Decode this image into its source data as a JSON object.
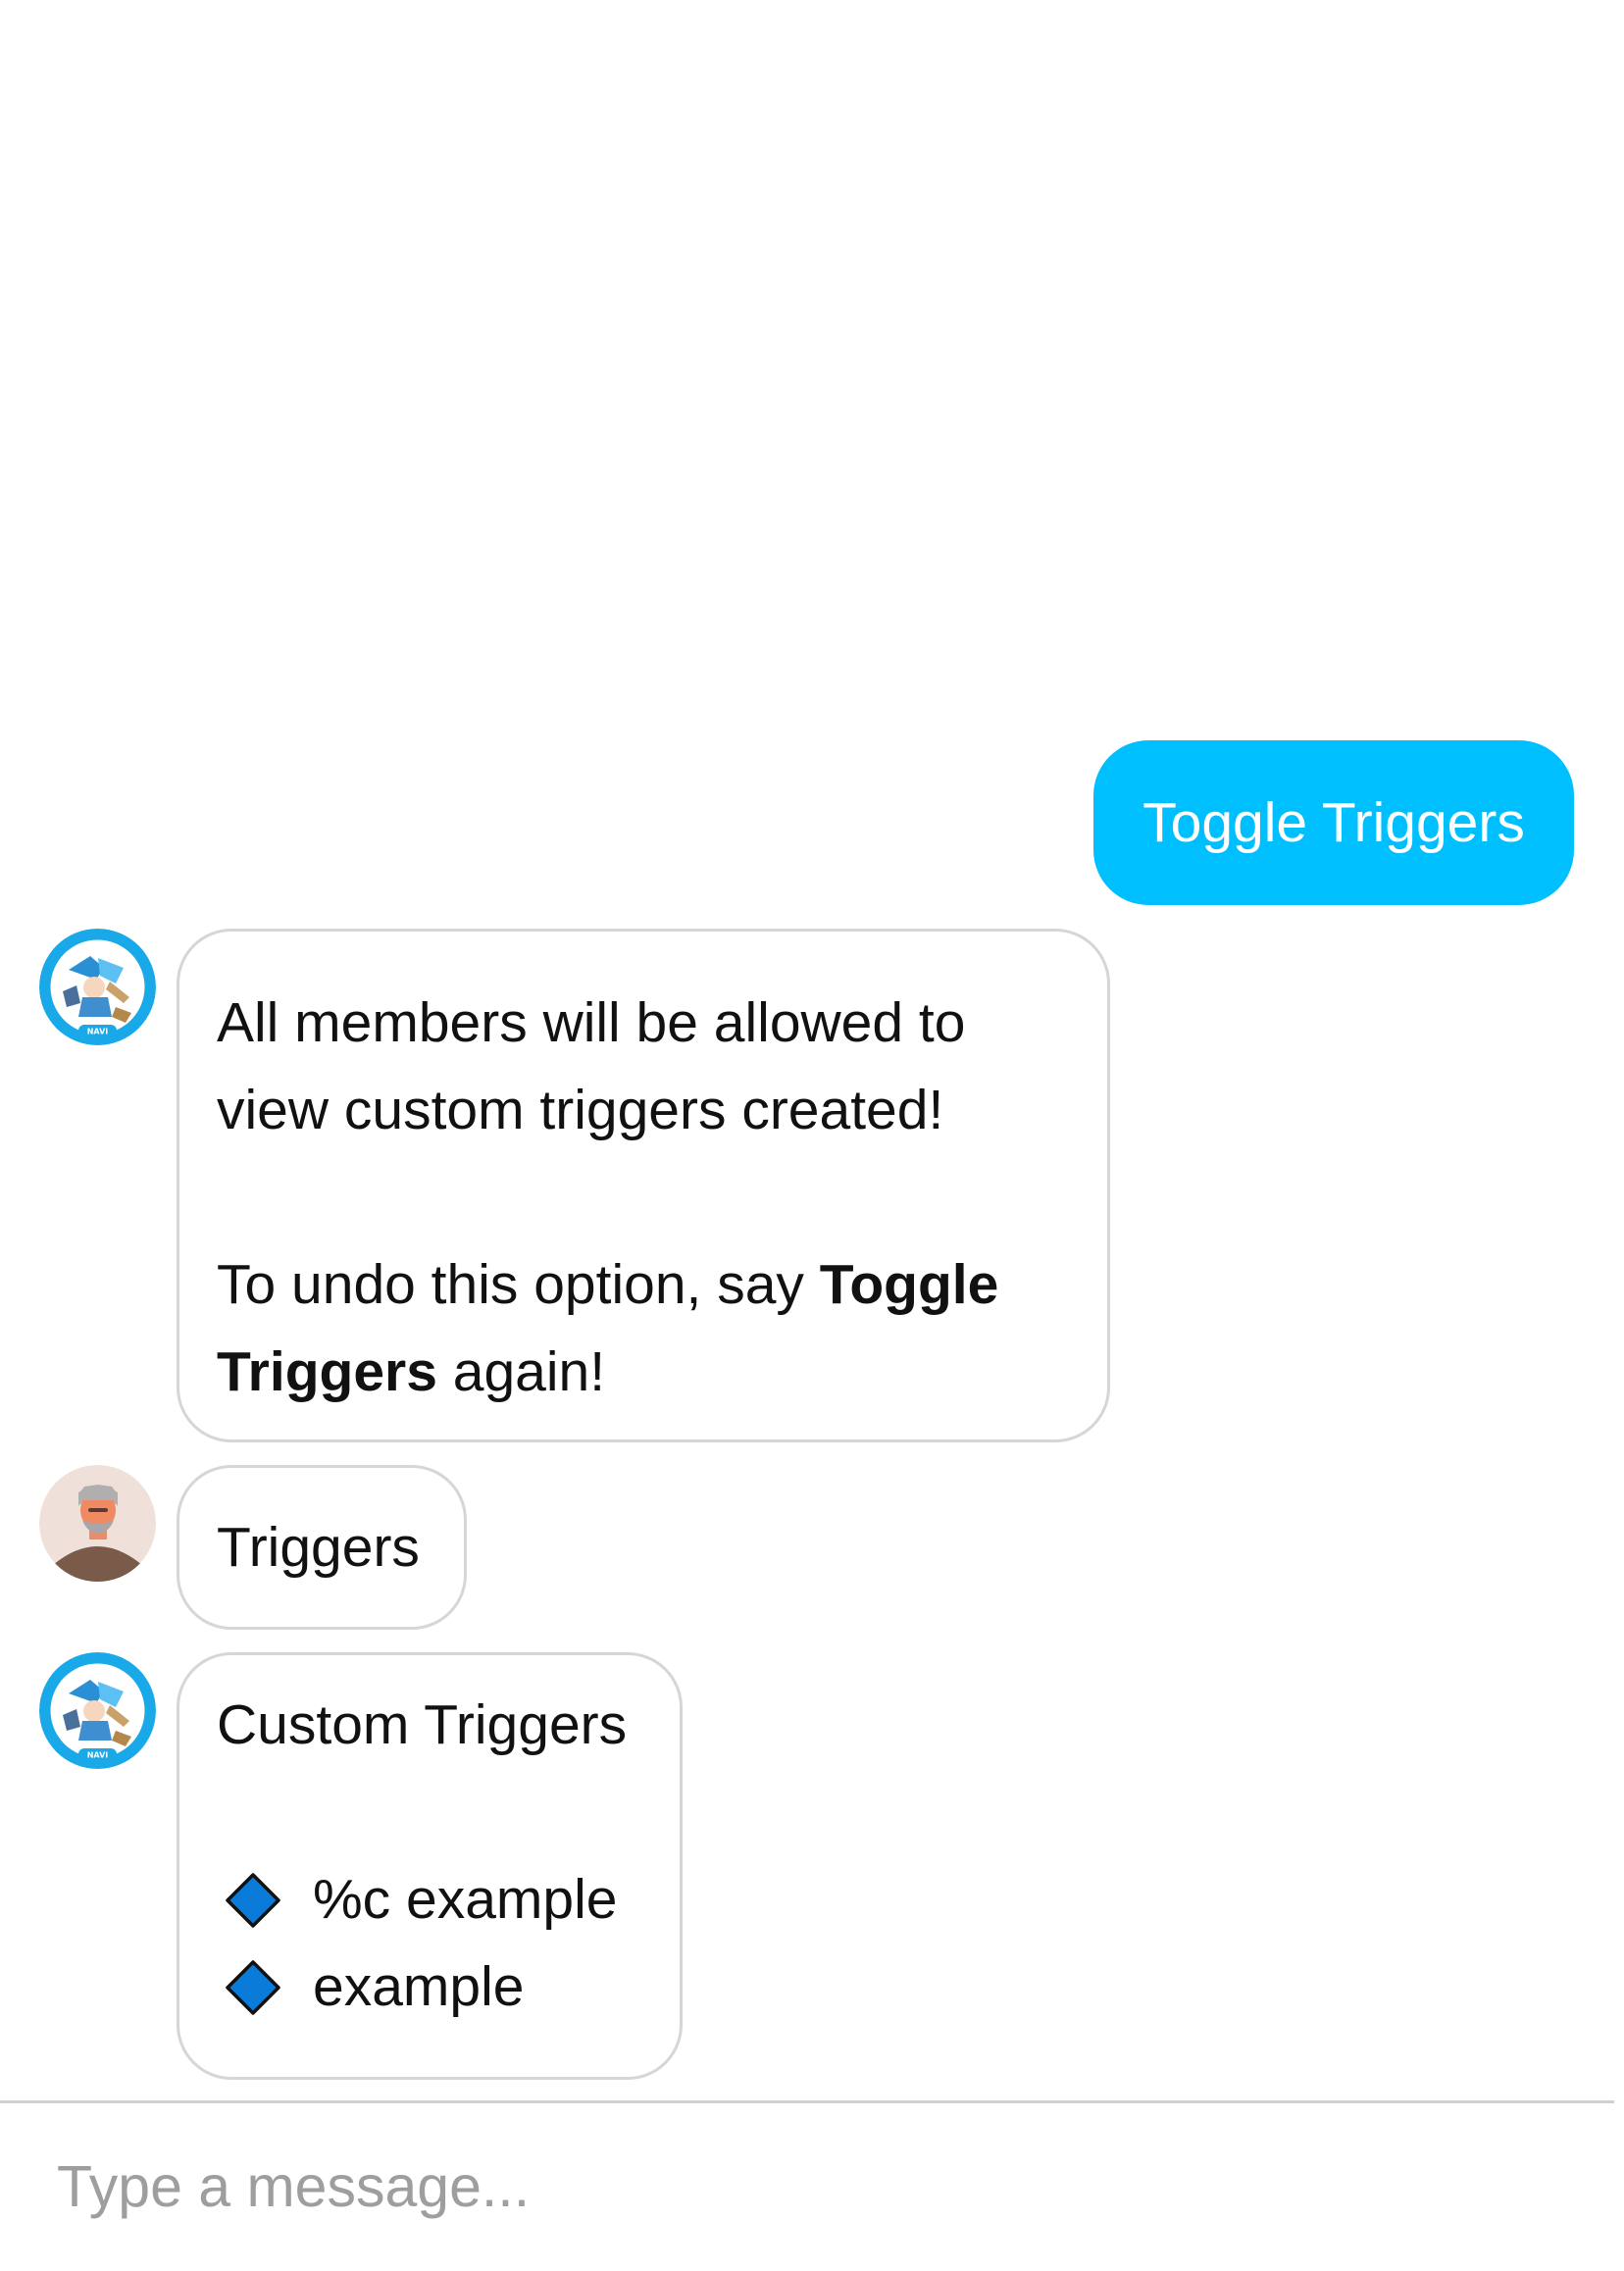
{
  "messages": {
    "user_toggle": "Toggle Triggers",
    "bot_reply_1": {
      "line1": "All members will be allowed to view custom triggers created!",
      "line2_prefix": "To undo this option, say ",
      "line2_bold": "Toggle Triggers",
      "line2_suffix": " again!"
    },
    "user_triggers": "Triggers",
    "bot_reply_2": {
      "title": "Custom Triggers",
      "items": [
        "%c example",
        "example"
      ]
    }
  },
  "avatars": {
    "bot_badge_text": "NAVI"
  },
  "composer": {
    "placeholder": "Type a message..."
  },
  "colors": {
    "user_bubble": "#00bfff",
    "bot_bubble_border": "#d6d6d6",
    "diamond_fill": "#0a7bd8",
    "avatar_ring": "#1aa9e8"
  }
}
